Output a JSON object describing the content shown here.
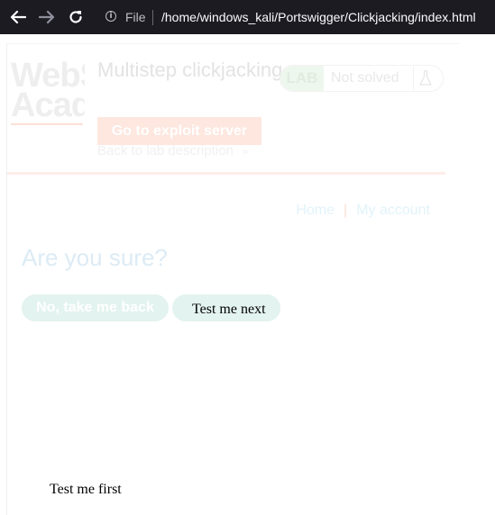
{
  "browser": {
    "back_icon": "arrow-left-icon",
    "forward_icon": "arrow-right-icon",
    "reload_icon": "reload-icon",
    "site_info_icon": "info-icon",
    "scheme_label": "File",
    "url": "/home/windows_kali/Portswigger/Clickjacking/index.html"
  },
  "victim_frame": {
    "logo_lines": [
      "WebS",
      "Acade"
    ],
    "lab_title": "Multistep clickjacking",
    "exploit_button": "Go to exploit server",
    "back_link": "Back to lab description",
    "back_link_icon": "chevron-right-icon",
    "lab_badge": "LAB",
    "lab_status": "Not solved",
    "status_icon": "flask-icon",
    "nav": {
      "home": "Home",
      "separator": "|",
      "account": "My account"
    },
    "heading": "Are you sure?",
    "no_button": "No, take me back"
  },
  "decoy": {
    "test_next": "Test me next",
    "test_first": "Test me first"
  },
  "colors": {
    "chrome_bg": "#1c1b22",
    "url_text": "#fbfbfe",
    "faded_orange": "#fde7df",
    "faded_green": "#e3f3ef"
  }
}
